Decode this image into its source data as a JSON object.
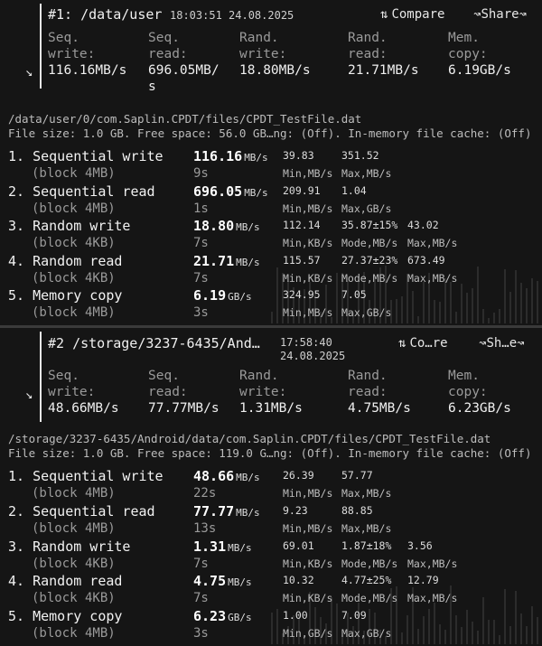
{
  "panels": [
    {
      "title": "#1: /data/user",
      "time": "18:03:51",
      "date": "24.08.2025",
      "compare_label": "Compare",
      "share_label": "Share",
      "summary": [
        {
          "l1": "Seq.",
          "l2": "write:",
          "v": "116.16MB/s"
        },
        {
          "l1": "Seq.",
          "l2": "read:",
          "v": "696.05MB/",
          "v2": "s"
        },
        {
          "l1": "Rand.",
          "l2": "write:",
          "v": "18.80MB/s"
        },
        {
          "l1": "Rand.",
          "l2": "read:",
          "v": "21.71MB/s"
        },
        {
          "l1": "Mem.",
          "l2": "copy:",
          "v": "6.19GB/s"
        }
      ],
      "path": "/data/user/0/com.Saplin.CPDT/files/CPDT_TestFile.dat",
      "fileinfo": "File size: 1.0 GB. Free space: 56.0 GB…ng: (Off). In-memory file cache: (Off)",
      "tests": [
        {
          "name": "1. Sequential write",
          "block": "(block 4MB)",
          "value": "116.16",
          "unit": "MB/s",
          "time": "9s",
          "stats": [
            {
              "v": "39.83",
              "l": "Min,MB/s"
            },
            {
              "v": "351.52",
              "l": "Max,MB/s"
            }
          ]
        },
        {
          "name": "2. Sequential read",
          "block": "(block 4MB)",
          "value": "696.05",
          "unit": "MB/s",
          "time": "1s",
          "stats": [
            {
              "v": "209.91",
              "l": "Min,MB/s"
            },
            {
              "v": "1.04",
              "l": "Max,GB/s"
            }
          ]
        },
        {
          "name": "3. Random write",
          "block": "(block 4KB)",
          "value": "18.80",
          "unit": "MB/s",
          "time": "7s",
          "stats": [
            {
              "v": "112.14",
              "l": "Min,KB/s"
            },
            {
              "v": "35.87±15%",
              "l": "Mode,MB/s"
            },
            {
              "v": "43.02",
              "l": "Max,MB/s"
            }
          ]
        },
        {
          "name": "4. Random read",
          "block": "(block 4KB)",
          "value": "21.71",
          "unit": "MB/s",
          "time": "7s",
          "stats": [
            {
              "v": "115.57",
              "l": "Min,KB/s"
            },
            {
              "v": "27.37±23%",
              "l": "Mode,MB/s"
            },
            {
              "v": "673.49",
              "l": "Max,MB/s"
            }
          ]
        },
        {
          "name": "5. Memory copy",
          "block": "(block 4MB)",
          "value": "6.19",
          "unit": "GB/s",
          "time": "3s",
          "stats": [
            {
              "v": "324.95",
              "l": "Min,MB/s"
            },
            {
              "v": "7.05",
              "l": "Max,GB/s"
            }
          ]
        }
      ]
    },
    {
      "title": "#2  /storage/3237-6435/And…",
      "time": "17:58:40",
      "date": "24.08.2025",
      "compare_label": "Co…re",
      "share_label": "Sh…e",
      "summary": [
        {
          "l1": "Seq.",
          "l2": "write:",
          "v": "48.66MB/s"
        },
        {
          "l1": "Seq.",
          "l2": "read:",
          "v": "77.77MB/s"
        },
        {
          "l1": "Rand.",
          "l2": "write:",
          "v": "1.31MB/s"
        },
        {
          "l1": "Rand.",
          "l2": "read:",
          "v": "4.75MB/s"
        },
        {
          "l1": "Mem.",
          "l2": "copy:",
          "v": "6.23GB/s"
        }
      ],
      "path": "/storage/3237-6435/Android/data/com.Saplin.CPDT/files/CPDT_TestFile.dat",
      "fileinfo": "File size: 1.0 GB. Free space: 119.0 G…ng: (Off). In-memory file cache: (Off)",
      "tests": [
        {
          "name": "1. Sequential write",
          "block": "(block 4MB)",
          "value": "48.66",
          "unit": "MB/s",
          "time": "22s",
          "stats": [
            {
              "v": "26.39",
              "l": "Min,MB/s"
            },
            {
              "v": "57.77",
              "l": "Max,MB/s"
            }
          ]
        },
        {
          "name": "2. Sequential read",
          "block": "(block 4MB)",
          "value": "77.77",
          "unit": "MB/s",
          "time": "13s",
          "stats": [
            {
              "v": "9.23",
              "l": "Min,MB/s"
            },
            {
              "v": "88.85",
              "l": "Max,MB/s"
            }
          ]
        },
        {
          "name": "3. Random write",
          "block": "(block 4KB)",
          "value": "1.31",
          "unit": "MB/s",
          "time": "7s",
          "stats": [
            {
              "v": "69.01",
              "l": "Min,KB/s"
            },
            {
              "v": "1.87±18%",
              "l": "Mode,MB/s"
            },
            {
              "v": "3.56",
              "l": "Max,MB/s"
            }
          ]
        },
        {
          "name": "4. Random read",
          "block": "(block 4KB)",
          "value": "4.75",
          "unit": "MB/s",
          "time": "7s",
          "stats": [
            {
              "v": "10.32",
              "l": "Min,KB/s"
            },
            {
              "v": "4.77±25%",
              "l": "Mode,MB/s"
            },
            {
              "v": "12.79",
              "l": "Max,MB/s"
            }
          ]
        },
        {
          "name": "5. Memory copy",
          "block": "(block 4MB)",
          "value": "6.23",
          "unit": "GB/s",
          "time": "3s",
          "stats": [
            {
              "v": "1.00",
              "l": "Min,GB/s"
            },
            {
              "v": "7.09",
              "l": "Max,GB/s"
            }
          ]
        }
      ]
    }
  ],
  "icons": {
    "compare": "swap-icon",
    "share": "share-icon",
    "expand": "expand-arrow-icon"
  }
}
